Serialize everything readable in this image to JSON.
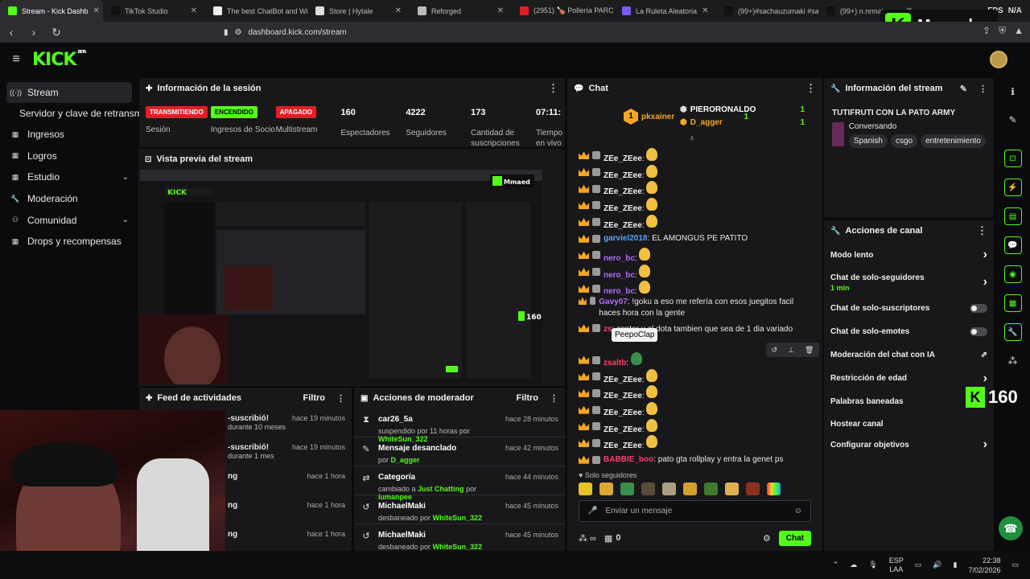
{
  "browser": {
    "tabs": [
      {
        "label": "Stream - Kick Dashb",
        "color": "#53fc18",
        "active": true
      },
      {
        "label": "TikTok Studio",
        "color": "#111"
      },
      {
        "label": "The best ChatBot and Wi",
        "color": "#eee"
      },
      {
        "label": "Store | Hytale",
        "color": "#ddd"
      },
      {
        "label": "Reforged",
        "color": "#bbb"
      },
      {
        "label": "(2951) 🍗 Pollería PARCHA",
        "color": "#e01f26"
      },
      {
        "label": "La Ruleta Aleatoria",
        "color": "#7a5af5"
      },
      {
        "label": "(99+)#sachauzumaki #sac",
        "color": "#111"
      },
      {
        "label": "(99+) n.nrmals",
        "color": "#111"
      }
    ],
    "fps_label": "FPS",
    "fps_value": "N/A",
    "url": "dashboard.kick.com/stream"
  },
  "overlay": {
    "brand": "Mmaed",
    "viewers": "160"
  },
  "sidebar": {
    "items": [
      {
        "label": "Stream",
        "icon": "stream-icon"
      },
      {
        "label": "Servidor y clave de retransmisión"
      },
      {
        "label": "Ingresos",
        "icon": "income-icon"
      },
      {
        "label": "Logros",
        "icon": "trophy-icon"
      },
      {
        "label": "Estudio",
        "icon": "studio-icon"
      },
      {
        "label": "Moderación",
        "icon": "wrench-icon"
      },
      {
        "label": "Comunidad",
        "icon": "community-icon"
      },
      {
        "label": "Drops y recompensas",
        "icon": "drops-icon"
      }
    ]
  },
  "session": {
    "title": "Información de la sesión",
    "stats": [
      {
        "badge": "TRANSMITIENDO",
        "label": "Sesión"
      },
      {
        "badge": "ENCENDIDO",
        "label": "Ingresos de Socio"
      },
      {
        "badge": "APAGADO",
        "label": "Multistream"
      },
      {
        "value": "160",
        "label": "Espectadores"
      },
      {
        "value": "4222",
        "label": "Seguidores"
      },
      {
        "value": "173",
        "label": "Cantidad de suscripciones"
      },
      {
        "value": "07:11:",
        "label": "Tiempo en vivo"
      }
    ]
  },
  "preview": {
    "title": "Vista previa del stream"
  },
  "activity": {
    "title": "Feed de actividades",
    "filter": "Filtro",
    "rows": [
      {
        "text": "-suscribió!",
        "time": "hace 19 minutos",
        "sub": "durante 10 meses"
      },
      {
        "text": "-suscribió!",
        "time": "hace 19 minutos",
        "sub": "durante 1 mes"
      },
      {
        "text": "ng",
        "time": "hace 1 hora",
        "sub": ""
      },
      {
        "text": "ng",
        "time": "hace 1 hora",
        "sub": ""
      },
      {
        "text": "ng",
        "time": "hace 1 hora",
        "sub": ""
      }
    ]
  },
  "modactions": {
    "title": "Acciones de moderador",
    "filter": "Filtro",
    "rows": [
      {
        "title": "car26_5a",
        "desc": "suspendido por 11 horas por",
        "who": "WhiteSun_322",
        "time": "hace 28 minutos"
      },
      {
        "title": "Mensaje desanclado",
        "desc": "por",
        "who": "D_agger",
        "time": "hace 42 minutos"
      },
      {
        "title": "Categoría",
        "desc": "cambiado a",
        "who": "Just Chatting",
        "desc2": "por",
        "who2": "lumanpee",
        "time": "hace 44 minutos"
      },
      {
        "title": "MichaelMaki",
        "desc": "desbaneado por",
        "who": "WhiteSun_322",
        "time": "hace 45 minutos"
      },
      {
        "title": "MichaelMaki",
        "desc": "desbaneado por",
        "who": "WhiteSun_322",
        "time": "hace 45 minutos"
      }
    ]
  },
  "chat": {
    "title": "Chat",
    "top": [
      {
        "rank": "1",
        "name": "pkxainer",
        "count": "1"
      },
      {
        "rank": "",
        "name": "PIERORONALDO",
        "count": "1"
      },
      {
        "rank": "",
        "name": "D_agger",
        "count": "1"
      }
    ],
    "messages": [
      {
        "user": "ZEe_ZEee",
        "color": "#f2f2f2",
        "text": ""
      },
      {
        "user": "ZEe_ZEee",
        "color": "#f2f2f2",
        "text": ""
      },
      {
        "user": "ZEe_ZEee",
        "color": "#f2f2f2",
        "text": ""
      },
      {
        "user": "ZEe_ZEee",
        "color": "#f2f2f2",
        "text": ""
      },
      {
        "user": "ZEe_ZEee",
        "color": "#f2f2f2",
        "text": ""
      },
      {
        "user": "garviel2018",
        "color": "#5aa0ff",
        "text": "EL AMONGUS PE PATITO"
      },
      {
        "user": "nero_bc",
        "color": "#b26bff",
        "text": ""
      },
      {
        "user": "nero_bc",
        "color": "#b26bff",
        "text": ""
      },
      {
        "user": "nero_bc",
        "color": "#b26bff",
        "text": ""
      },
      {
        "user": "Gavy07",
        "color": "#b26bff",
        "text": "!goku a eso me refería con esos juegitos facil haces hora con la gente"
      },
      {
        "user": "zs",
        "color": "#ff3f6b",
        "text": "conter y el dota tambien que sea de 1 dia variado"
      },
      {
        "user": "zsaltb",
        "color": "#ff3f6b",
        "text": ""
      },
      {
        "user": "ZEe_ZEee",
        "color": "#f2f2f2",
        "text": ""
      },
      {
        "user": "ZEe_ZEee",
        "color": "#f2f2f2",
        "text": ""
      },
      {
        "user": "ZEe_ZEee",
        "color": "#f2f2f2",
        "text": ""
      },
      {
        "user": "ZEe_ZEee",
        "color": "#f2f2f2",
        "text": ""
      },
      {
        "user": "ZEe_ZEee",
        "color": "#f2f2f2",
        "text": ""
      },
      {
        "user": "BABBIE_boo",
        "color": "#ff3f6b",
        "text": "pato gta rollplay y entra la genet ps"
      }
    ],
    "tooltip": "PeepoClap",
    "followers_only": "Solo seguidores",
    "placeholder": "Enviar un mensaje",
    "counter": "0",
    "send": "Chat"
  },
  "stream_info": {
    "title": "Información del stream",
    "stream_title": "TUTIFRUTI CON LA PATO ARMY",
    "category": "Conversando",
    "tags": [
      "Spanish",
      "csgo",
      "entretenimiento"
    ]
  },
  "channel": {
    "title": "Acciones de canal",
    "items": [
      {
        "label": "Modo lento",
        "control": "chevron"
      },
      {
        "label": "Chat de solo-seguidores",
        "sub": "1 min",
        "control": "chevron"
      },
      {
        "label": "Chat de solo-suscriptores",
        "control": "toggle"
      },
      {
        "label": "Chat de solo-emotes",
        "control": "toggle"
      },
      {
        "label": "Moderación del chat con IA",
        "control": "external"
      },
      {
        "label": "Restricción de edad",
        "control": "chevron"
      },
      {
        "label": "Palabras baneadas",
        "control": ""
      },
      {
        "label": "Hostear canal",
        "control": ""
      },
      {
        "label": "Configurar objetivos",
        "control": "chevron"
      }
    ]
  },
  "taskbar": {
    "lang": "ESP",
    "lang2": "LAA",
    "time": "22:38",
    "date": "7/02/2026"
  }
}
